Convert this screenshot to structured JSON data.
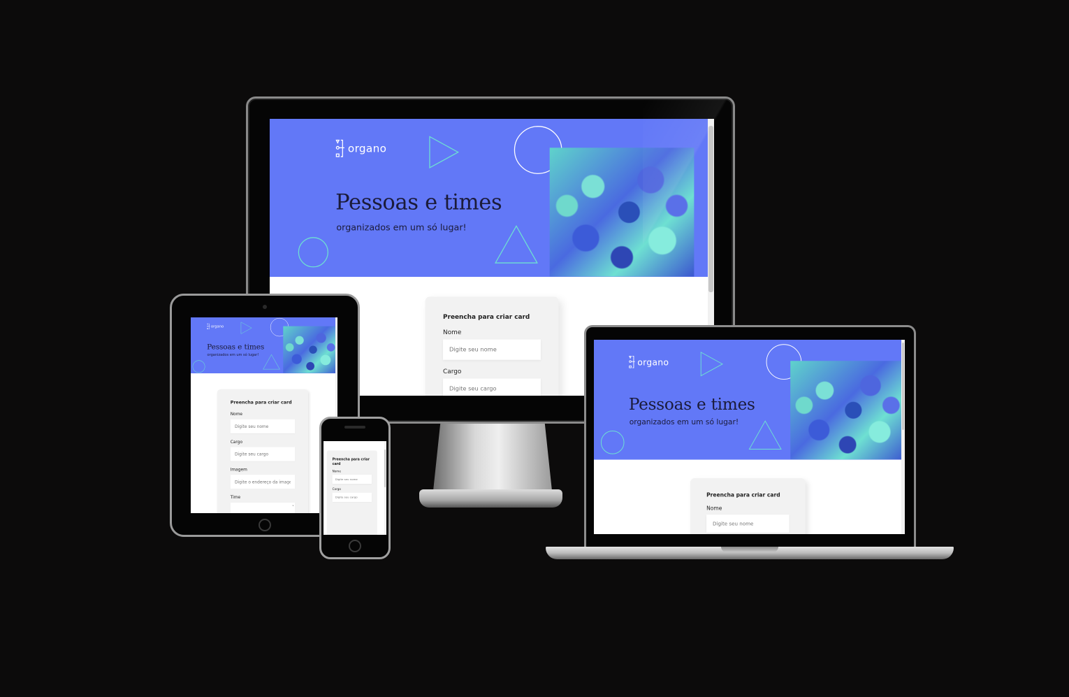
{
  "app": {
    "logo_text": "organo",
    "hero_title": "Pessoas e times",
    "hero_subtitle": "organizados em um só lugar!"
  },
  "form": {
    "title": "Preencha para criar card",
    "fields": [
      {
        "label": "Nome",
        "placeholder": "Digite seu nome"
      },
      {
        "label": "Cargo",
        "placeholder": "Digite seu cargo"
      },
      {
        "label": "Imagem",
        "placeholder": "Digite o endereço da imagem"
      },
      {
        "label": "Time",
        "placeholder": ""
      }
    ]
  },
  "colors": {
    "hero_bg": "#6278f7",
    "accent_line": "#6ee0d2",
    "text_dark": "#1b1b3a",
    "card_bg": "#f2f2f2"
  },
  "icons": [
    "organo-logo-icon",
    "play-triangle-icon",
    "circle-outline-icon",
    "triangle-outline-icon",
    "chevron-down-icon"
  ]
}
